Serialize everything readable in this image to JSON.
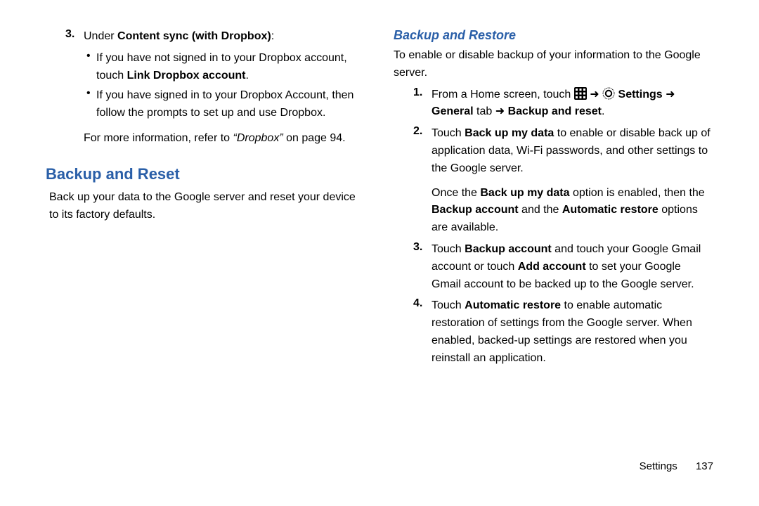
{
  "left": {
    "step3_num": "3.",
    "step3_pre": "Under ",
    "step3_bold": "Content sync (with Dropbox)",
    "step3_post": ":",
    "b1_pre": "If you have not signed in to your Dropbox account, touch ",
    "b1_bold": "Link Dropbox account",
    "b1_post": ".",
    "b2": "If you have signed in to your Dropbox Account, then follow the prompts to set up and use Dropbox.",
    "ref_pre": "For more information, refer to ",
    "ref_ital": "“Dropbox”",
    "ref_post": " on page 94.",
    "heading": "Backup and Reset",
    "body": "Back up your data to the Google server and reset your device to its factory defaults."
  },
  "right": {
    "heading": "Backup and Restore",
    "intro": "To enable or disable backup of your information to the Google server.",
    "s1": {
      "num": "1.",
      "pre": "From a Home screen, touch ",
      "arrow": " ➜ ",
      "bold1": "Settings",
      "arrow2": " ➜ ",
      "bold2": "General",
      "mid": " tab ",
      "arrow3": "➜ ",
      "bold3": "Backup and reset",
      "post": "."
    },
    "s2": {
      "num": "2.",
      "pre": "Touch ",
      "bold1": "Back up my data",
      "post1": " to enable or disable back up of application data, Wi-Fi passwords, and other settings to the Google server.",
      "p2_pre": "Once the ",
      "p2_b1": "Back up my data",
      "p2_mid1": " option is enabled, then the ",
      "p2_b2": "Backup account",
      "p2_mid2": " and the ",
      "p2_b3": "Automatic restore",
      "p2_post": " options are available."
    },
    "s3": {
      "num": "3.",
      "pre": "Touch ",
      "b1": "Backup account",
      "mid1": " and touch your Google Gmail account or touch ",
      "b2": "Add account",
      "post": " to set your Google Gmail account to be backed up to the Google server."
    },
    "s4": {
      "num": "4.",
      "pre": "Touch ",
      "b1": "Automatic restore",
      "post": " to enable automatic restoration of settings from the Google server. When enabled, backed-up settings are restored when you reinstall an application."
    }
  },
  "footer": {
    "section": "Settings",
    "page": "137"
  }
}
